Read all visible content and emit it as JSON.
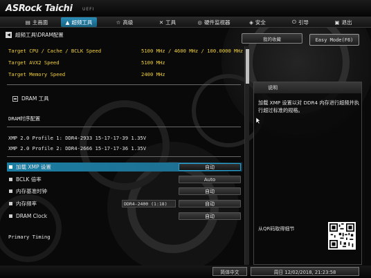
{
  "brand": {
    "name": "ASRock Taichi",
    "suffix": "UEFI"
  },
  "nav": {
    "tabs": [
      {
        "label": "主画面",
        "icon": "home-icon"
      },
      {
        "label": "超频工具",
        "icon": "rocket-icon",
        "active": true
      },
      {
        "label": "高级",
        "icon": "star-icon"
      },
      {
        "label": "工具",
        "icon": "wrench-icon"
      },
      {
        "label": "硬件监视器",
        "icon": "monitor-icon"
      },
      {
        "label": "安全",
        "icon": "shield-icon"
      },
      {
        "label": "引导",
        "icon": "power-icon"
      },
      {
        "label": "退出",
        "icon": "exit-icon"
      }
    ]
  },
  "breadcrumb": "超频工具\\DRAM配置",
  "buttons": {
    "favorites": "我的收藏",
    "easy_mode": "Easy Mode(F6)"
  },
  "targets": [
    {
      "label": "Target CPU / Cache / BCLK Speed",
      "value": "5100 MHz / 4600 MHz / 100.0000 MHz"
    },
    {
      "label": "Target AVX2 Speed",
      "value": "5100 MHz"
    },
    {
      "label": "Target Memory Speed",
      "value": "2400 MHz"
    }
  ],
  "dram_tool": "DRAM 工具",
  "timing_config": "DRAM时序配置",
  "xmp_profiles": [
    "XMP 2.0 Profile 1: DDR4-2933 15-17-17-39 1.35V",
    "XMP 2.0 Profile 2: DDR4-2666 15-17-17-36 1.35V"
  ],
  "settings": [
    {
      "label": "加载 XMP 设置",
      "option": "自动",
      "selected": true
    },
    {
      "label": "BCLK 倍率",
      "option": "Auto"
    },
    {
      "label": "内存基准时钟",
      "option": "自动"
    },
    {
      "label": "内存频率",
      "info": "DDR4-2400 (1:18)",
      "option": "自动"
    },
    {
      "label": "DRAM Clock",
      "option": "自动"
    }
  ],
  "primary_timing": "Primary Timing",
  "description": {
    "title": "说明",
    "text": "加载 XMP 设置以对 DDR4 内存进行超频并执行超过标准的规格。",
    "qr_label": "从QR码取得细节"
  },
  "footer": {
    "language": "简体中文",
    "datetime": "周日 12/02/2018, 21:23:58"
  },
  "colors": {
    "accent": "#1c7da3",
    "highlight": "#f2d13c"
  }
}
